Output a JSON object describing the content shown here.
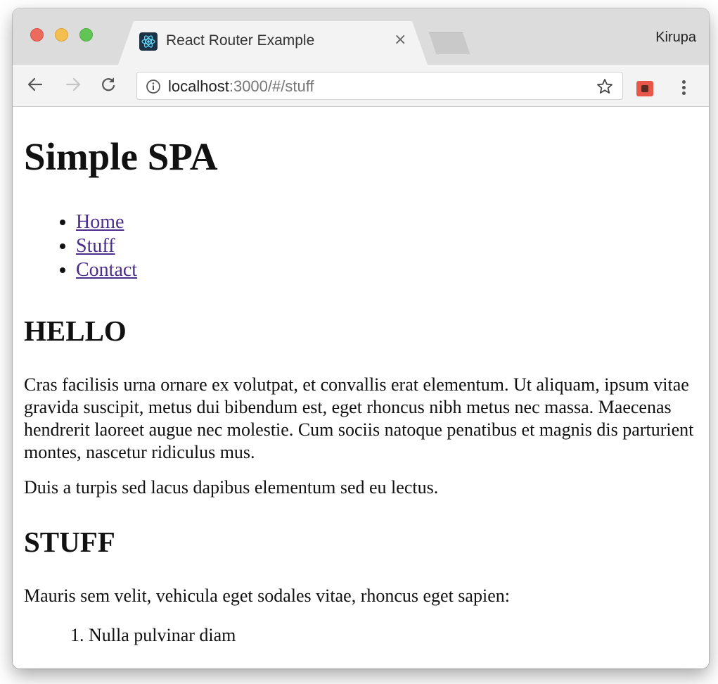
{
  "browser": {
    "tab_title": "React Router Example",
    "tab_close": "×",
    "profile_name": "Kirupa",
    "url_host": "localhost",
    "url_rest": ":3000/#/stuff"
  },
  "page": {
    "title": "Simple SPA",
    "nav": [
      {
        "label": "Home"
      },
      {
        "label": "Stuff"
      },
      {
        "label": "Contact"
      }
    ],
    "hello_heading": "HELLO",
    "hello_paragraph_1": "Cras facilisis urna ornare ex volutpat, et convallis erat elementum. Ut aliquam, ipsum vitae gravida suscipit, metus dui bibendum est, eget rhoncus nibh metus nec massa. Maecenas hendrerit laoreet augue nec molestie. Cum sociis natoque penatibus et magnis dis parturient montes, nascetur ridiculus mus.",
    "hello_paragraph_2": "Duis a turpis sed lacus dapibus elementum sed eu lectus.",
    "stuff_heading": "STUFF",
    "stuff_paragraph": "Mauris sem velit, vehicula eget sodales vitae, rhoncus eget sapien:",
    "stuff_list": [
      {
        "label": "Nulla pulvinar diam"
      }
    ]
  },
  "colors": {
    "link": "#4b2e8a",
    "tabstrip": "#dcdcdc",
    "close_red": "#ec6a5e",
    "minimize_yellow": "#f4bf4f",
    "zoom_green": "#61c454"
  },
  "icons": {
    "back": "back-arrow-icon",
    "forward": "forward-arrow-icon",
    "reload": "reload-icon",
    "info": "info-icon",
    "bookmark": "star-icon",
    "extension": "extension-icon",
    "menu": "kebab-menu-icon",
    "favicon": "react-logo-icon"
  }
}
